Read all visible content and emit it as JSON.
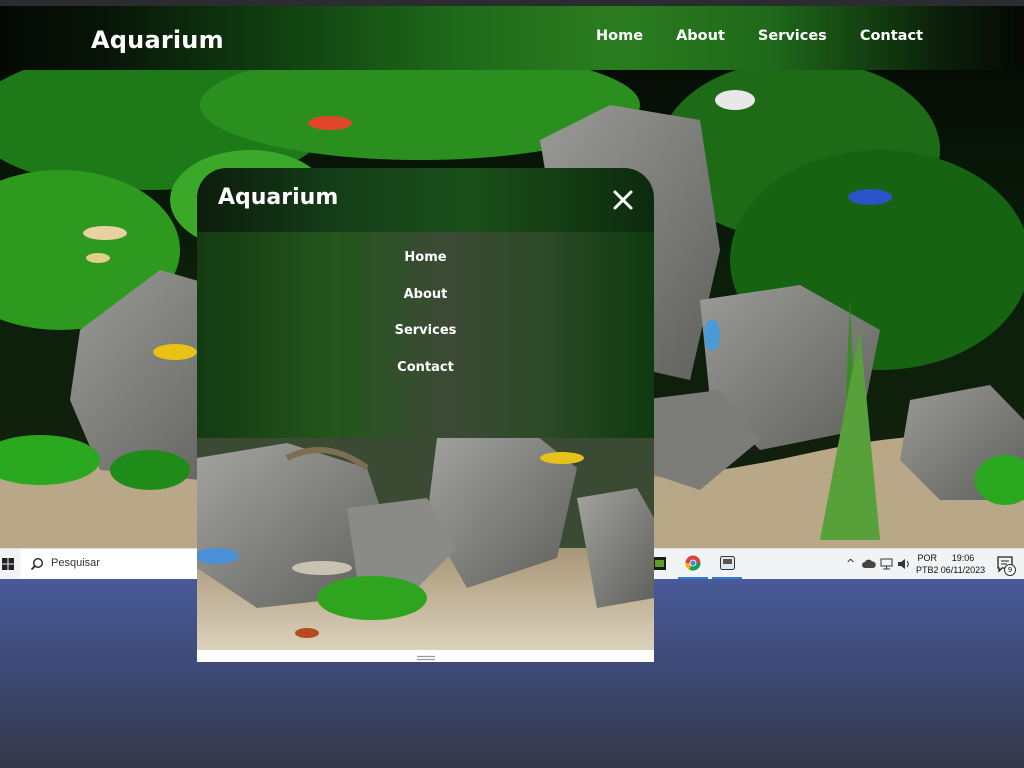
{
  "site": {
    "brand": "Aquarium",
    "nav": [
      "Home",
      "About",
      "Services",
      "Contact"
    ]
  },
  "phone": {
    "brand": "Aquarium",
    "close_icon": "close-icon",
    "menu": [
      "Home",
      "About",
      "Services",
      "Contact"
    ]
  },
  "taskbar": {
    "search_placeholder": "Pesquisar",
    "lang_top": "POR",
    "lang_bottom": "PTB2",
    "time": "19:06",
    "date": "06/11/2023",
    "notification_count": "9"
  },
  "colors": {
    "nav_green": "#2b7c1f",
    "desktop_blue": "#485a98",
    "taskbar": "#f2f3f5",
    "text": "#ffffff"
  }
}
